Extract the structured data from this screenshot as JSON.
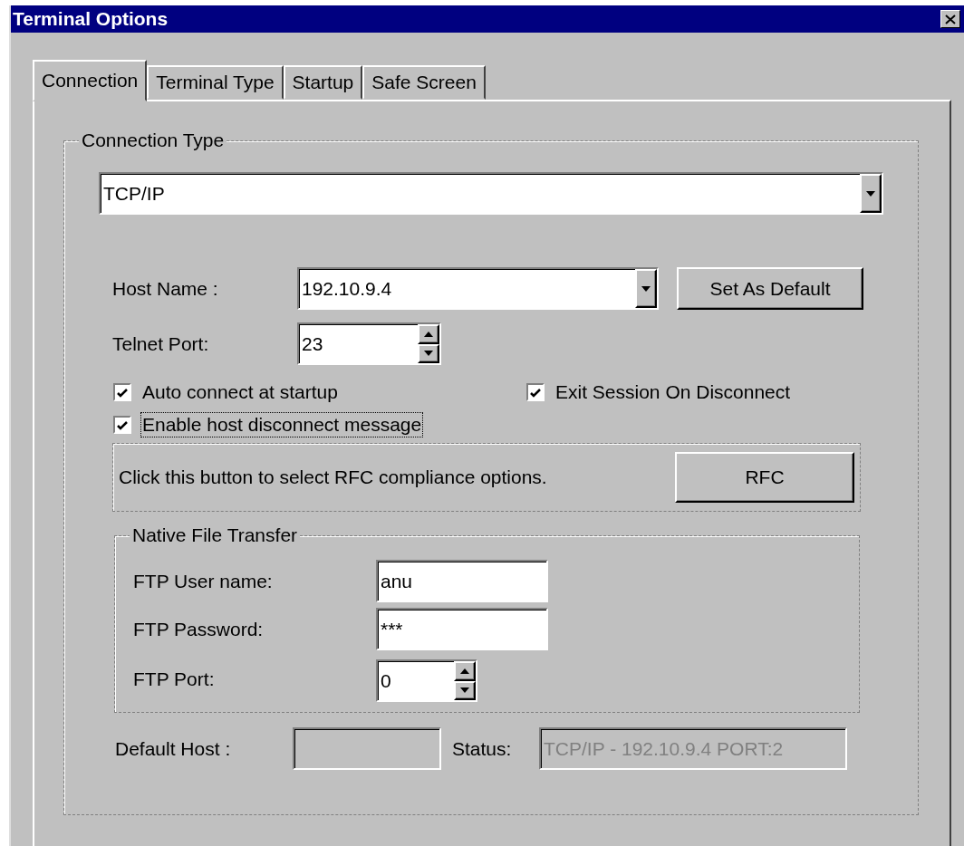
{
  "window": {
    "title": "Terminal Options"
  },
  "tabs": [
    {
      "label": "Connection",
      "selected": true
    },
    {
      "label": "Terminal Type",
      "selected": false
    },
    {
      "label": "Startup",
      "selected": false
    },
    {
      "label": "Safe Screen",
      "selected": false
    }
  ],
  "connection_type": {
    "legend": "Connection Type",
    "value": "TCP/IP"
  },
  "host_name": {
    "label": "Host Name :",
    "value": "192.10.9.4",
    "button": "Set As Default"
  },
  "telnet_port": {
    "label": "Telnet Port:",
    "value": "23"
  },
  "checkboxes": [
    {
      "label": "Auto connect at startup",
      "checked": true,
      "focused": false
    },
    {
      "label": "Exit Session On Disconnect",
      "checked": true,
      "focused": false
    },
    {
      "label": "Enable host disconnect message",
      "checked": true,
      "focused": true
    }
  ],
  "rfc": {
    "text": "Click this button to select RFC compliance options.",
    "button": "RFC"
  },
  "native_file_transfer": {
    "legend": "Native File Transfer",
    "fields": [
      {
        "kind": "text",
        "label": "FTP User name:",
        "value": "anu"
      },
      {
        "kind": "text",
        "label": "FTP Password:",
        "value": "***"
      },
      {
        "kind": "spin",
        "label": "FTP Port:",
        "value": "0"
      }
    ]
  },
  "default_host": {
    "label": "Default Host :",
    "disabled": true
  },
  "status": {
    "label": "Status:",
    "value": "TCP/IP - 192.10.9.4 PORT:2",
    "disabled": true
  }
}
